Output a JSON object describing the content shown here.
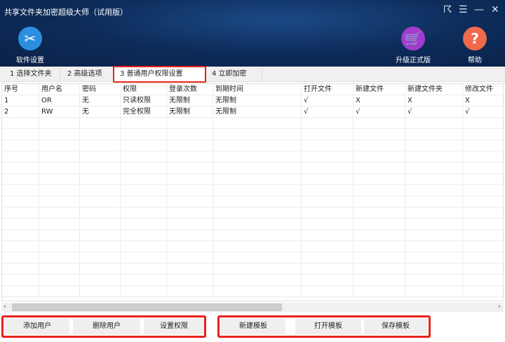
{
  "window": {
    "title": "共享文件夹加密超级大师（试用版）",
    "controls": [
      "☈",
      "☰",
      "—",
      "✕"
    ]
  },
  "toolbar": {
    "settings": "软件设置",
    "upgrade": "升级正式版",
    "help": "帮助"
  },
  "tabs": [
    "1 选择文件夹",
    "2 高级选项",
    "3 普通用户权限设置",
    "4 立即加密"
  ],
  "active_tab": 2,
  "table": {
    "headers": [
      "序号",
      "用户名",
      "密码",
      "权限",
      "登录次数",
      "到期时间",
      "打开文件",
      "新建文件",
      "新建文件夹",
      "修改文件"
    ],
    "rows": [
      [
        "1",
        "OR",
        "无",
        "只读权限",
        "无限制",
        "无限制",
        "√",
        "X",
        "X",
        "X"
      ],
      [
        "2",
        "RW",
        "无",
        "完全权限",
        "无限制",
        "无限制",
        "√",
        "√",
        "√",
        "√"
      ]
    ]
  },
  "buttons_left": [
    "添加用户",
    "删除用户",
    "设置权限"
  ],
  "buttons_right": [
    "新建模板",
    "打开模板",
    "保存模板"
  ],
  "colors": {
    "highlight": "#e8221c",
    "header_bg": "#0d2c5a"
  }
}
